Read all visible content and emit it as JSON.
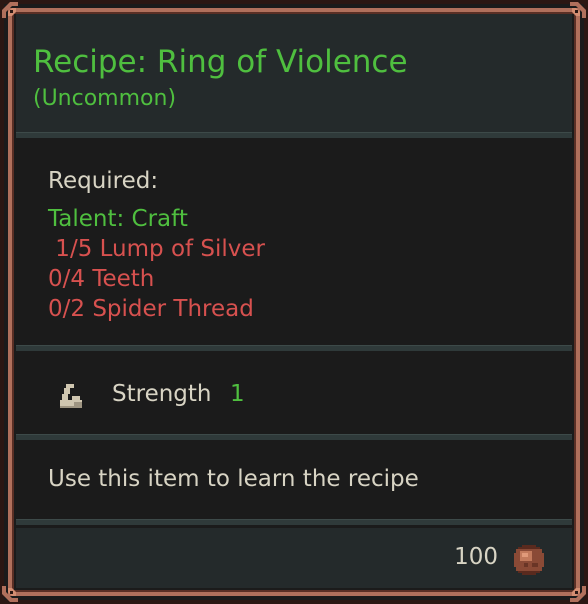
{
  "item": {
    "title": "Recipe: Ring of Violence",
    "rarity": "(Uncommon)",
    "required_label": "Required:",
    "talent": "Talent: Craft",
    "requirements": [
      " 1/5 Lump of Silver",
      "0/4 Teeth",
      "0/2 Spider Thread"
    ],
    "stat": {
      "name": "Strength",
      "value": "1",
      "icon": "arm-flex-icon"
    },
    "description": "Use this item to learn the recipe",
    "price": "100",
    "currency_icon": "copper-coin-icon"
  },
  "colors": {
    "uncommon_green": "#4fbf3f",
    "missing_red": "#d7514f",
    "text": "#d8d4c4",
    "frame": "#b0705c"
  }
}
